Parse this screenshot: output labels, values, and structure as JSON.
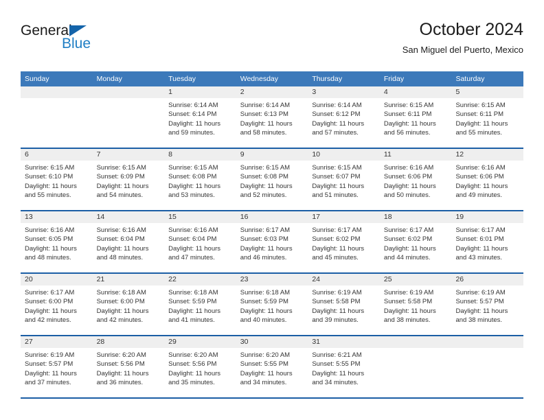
{
  "brand": {
    "name_part1": "General",
    "name_part2": "Blue",
    "triangle_color": "#1464aa",
    "blue_color": "#1f7ec4"
  },
  "header": {
    "title": "October 2024",
    "subtitle": "San Miguel del Puerto, Mexico"
  },
  "theme": {
    "header_blue": "#3c79ba",
    "divider_blue": "#1b5ea5",
    "date_band_gray": "#efefef"
  },
  "weekdays": [
    "Sunday",
    "Monday",
    "Tuesday",
    "Wednesday",
    "Thursday",
    "Friday",
    "Saturday"
  ],
  "weeks": [
    [
      {
        "day": "",
        "empty": true,
        "sunrise": "",
        "sunset": "",
        "daylight": ""
      },
      {
        "day": "",
        "empty": true,
        "sunrise": "",
        "sunset": "",
        "daylight": ""
      },
      {
        "day": "1",
        "empty": false,
        "sunrise": "Sunrise: 6:14 AM",
        "sunset": "Sunset: 6:14 PM",
        "daylight": "Daylight: 11 hours and 59 minutes."
      },
      {
        "day": "2",
        "empty": false,
        "sunrise": "Sunrise: 6:14 AM",
        "sunset": "Sunset: 6:13 PM",
        "daylight": "Daylight: 11 hours and 58 minutes."
      },
      {
        "day": "3",
        "empty": false,
        "sunrise": "Sunrise: 6:14 AM",
        "sunset": "Sunset: 6:12 PM",
        "daylight": "Daylight: 11 hours and 57 minutes."
      },
      {
        "day": "4",
        "empty": false,
        "sunrise": "Sunrise: 6:15 AM",
        "sunset": "Sunset: 6:11 PM",
        "daylight": "Daylight: 11 hours and 56 minutes."
      },
      {
        "day": "5",
        "empty": false,
        "sunrise": "Sunrise: 6:15 AM",
        "sunset": "Sunset: 6:11 PM",
        "daylight": "Daylight: 11 hours and 55 minutes."
      }
    ],
    [
      {
        "day": "6",
        "empty": false,
        "sunrise": "Sunrise: 6:15 AM",
        "sunset": "Sunset: 6:10 PM",
        "daylight": "Daylight: 11 hours and 55 minutes."
      },
      {
        "day": "7",
        "empty": false,
        "sunrise": "Sunrise: 6:15 AM",
        "sunset": "Sunset: 6:09 PM",
        "daylight": "Daylight: 11 hours and 54 minutes."
      },
      {
        "day": "8",
        "empty": false,
        "sunrise": "Sunrise: 6:15 AM",
        "sunset": "Sunset: 6:08 PM",
        "daylight": "Daylight: 11 hours and 53 minutes."
      },
      {
        "day": "9",
        "empty": false,
        "sunrise": "Sunrise: 6:15 AM",
        "sunset": "Sunset: 6:08 PM",
        "daylight": "Daylight: 11 hours and 52 minutes."
      },
      {
        "day": "10",
        "empty": false,
        "sunrise": "Sunrise: 6:15 AM",
        "sunset": "Sunset: 6:07 PM",
        "daylight": "Daylight: 11 hours and 51 minutes."
      },
      {
        "day": "11",
        "empty": false,
        "sunrise": "Sunrise: 6:16 AM",
        "sunset": "Sunset: 6:06 PM",
        "daylight": "Daylight: 11 hours and 50 minutes."
      },
      {
        "day": "12",
        "empty": false,
        "sunrise": "Sunrise: 6:16 AM",
        "sunset": "Sunset: 6:06 PM",
        "daylight": "Daylight: 11 hours and 49 minutes."
      }
    ],
    [
      {
        "day": "13",
        "empty": false,
        "sunrise": "Sunrise: 6:16 AM",
        "sunset": "Sunset: 6:05 PM",
        "daylight": "Daylight: 11 hours and 48 minutes."
      },
      {
        "day": "14",
        "empty": false,
        "sunrise": "Sunrise: 6:16 AM",
        "sunset": "Sunset: 6:04 PM",
        "daylight": "Daylight: 11 hours and 48 minutes."
      },
      {
        "day": "15",
        "empty": false,
        "sunrise": "Sunrise: 6:16 AM",
        "sunset": "Sunset: 6:04 PM",
        "daylight": "Daylight: 11 hours and 47 minutes."
      },
      {
        "day": "16",
        "empty": false,
        "sunrise": "Sunrise: 6:17 AM",
        "sunset": "Sunset: 6:03 PM",
        "daylight": "Daylight: 11 hours and 46 minutes."
      },
      {
        "day": "17",
        "empty": false,
        "sunrise": "Sunrise: 6:17 AM",
        "sunset": "Sunset: 6:02 PM",
        "daylight": "Daylight: 11 hours and 45 minutes."
      },
      {
        "day": "18",
        "empty": false,
        "sunrise": "Sunrise: 6:17 AM",
        "sunset": "Sunset: 6:02 PM",
        "daylight": "Daylight: 11 hours and 44 minutes."
      },
      {
        "day": "19",
        "empty": false,
        "sunrise": "Sunrise: 6:17 AM",
        "sunset": "Sunset: 6:01 PM",
        "daylight": "Daylight: 11 hours and 43 minutes."
      }
    ],
    [
      {
        "day": "20",
        "empty": false,
        "sunrise": "Sunrise: 6:17 AM",
        "sunset": "Sunset: 6:00 PM",
        "daylight": "Daylight: 11 hours and 42 minutes."
      },
      {
        "day": "21",
        "empty": false,
        "sunrise": "Sunrise: 6:18 AM",
        "sunset": "Sunset: 6:00 PM",
        "daylight": "Daylight: 11 hours and 42 minutes."
      },
      {
        "day": "22",
        "empty": false,
        "sunrise": "Sunrise: 6:18 AM",
        "sunset": "Sunset: 5:59 PM",
        "daylight": "Daylight: 11 hours and 41 minutes."
      },
      {
        "day": "23",
        "empty": false,
        "sunrise": "Sunrise: 6:18 AM",
        "sunset": "Sunset: 5:59 PM",
        "daylight": "Daylight: 11 hours and 40 minutes."
      },
      {
        "day": "24",
        "empty": false,
        "sunrise": "Sunrise: 6:19 AM",
        "sunset": "Sunset: 5:58 PM",
        "daylight": "Daylight: 11 hours and 39 minutes."
      },
      {
        "day": "25",
        "empty": false,
        "sunrise": "Sunrise: 6:19 AM",
        "sunset": "Sunset: 5:58 PM",
        "daylight": "Daylight: 11 hours and 38 minutes."
      },
      {
        "day": "26",
        "empty": false,
        "sunrise": "Sunrise: 6:19 AM",
        "sunset": "Sunset: 5:57 PM",
        "daylight": "Daylight: 11 hours and 38 minutes."
      }
    ],
    [
      {
        "day": "27",
        "empty": false,
        "sunrise": "Sunrise: 6:19 AM",
        "sunset": "Sunset: 5:57 PM",
        "daylight": "Daylight: 11 hours and 37 minutes."
      },
      {
        "day": "28",
        "empty": false,
        "sunrise": "Sunrise: 6:20 AM",
        "sunset": "Sunset: 5:56 PM",
        "daylight": "Daylight: 11 hours and 36 minutes."
      },
      {
        "day": "29",
        "empty": false,
        "sunrise": "Sunrise: 6:20 AM",
        "sunset": "Sunset: 5:56 PM",
        "daylight": "Daylight: 11 hours and 35 minutes."
      },
      {
        "day": "30",
        "empty": false,
        "sunrise": "Sunrise: 6:20 AM",
        "sunset": "Sunset: 5:55 PM",
        "daylight": "Daylight: 11 hours and 34 minutes."
      },
      {
        "day": "31",
        "empty": false,
        "sunrise": "Sunrise: 6:21 AM",
        "sunset": "Sunset: 5:55 PM",
        "daylight": "Daylight: 11 hours and 34 minutes."
      },
      {
        "day": "",
        "empty": true,
        "sunrise": "",
        "sunset": "",
        "daylight": ""
      },
      {
        "day": "",
        "empty": true,
        "sunrise": "",
        "sunset": "",
        "daylight": ""
      }
    ]
  ]
}
